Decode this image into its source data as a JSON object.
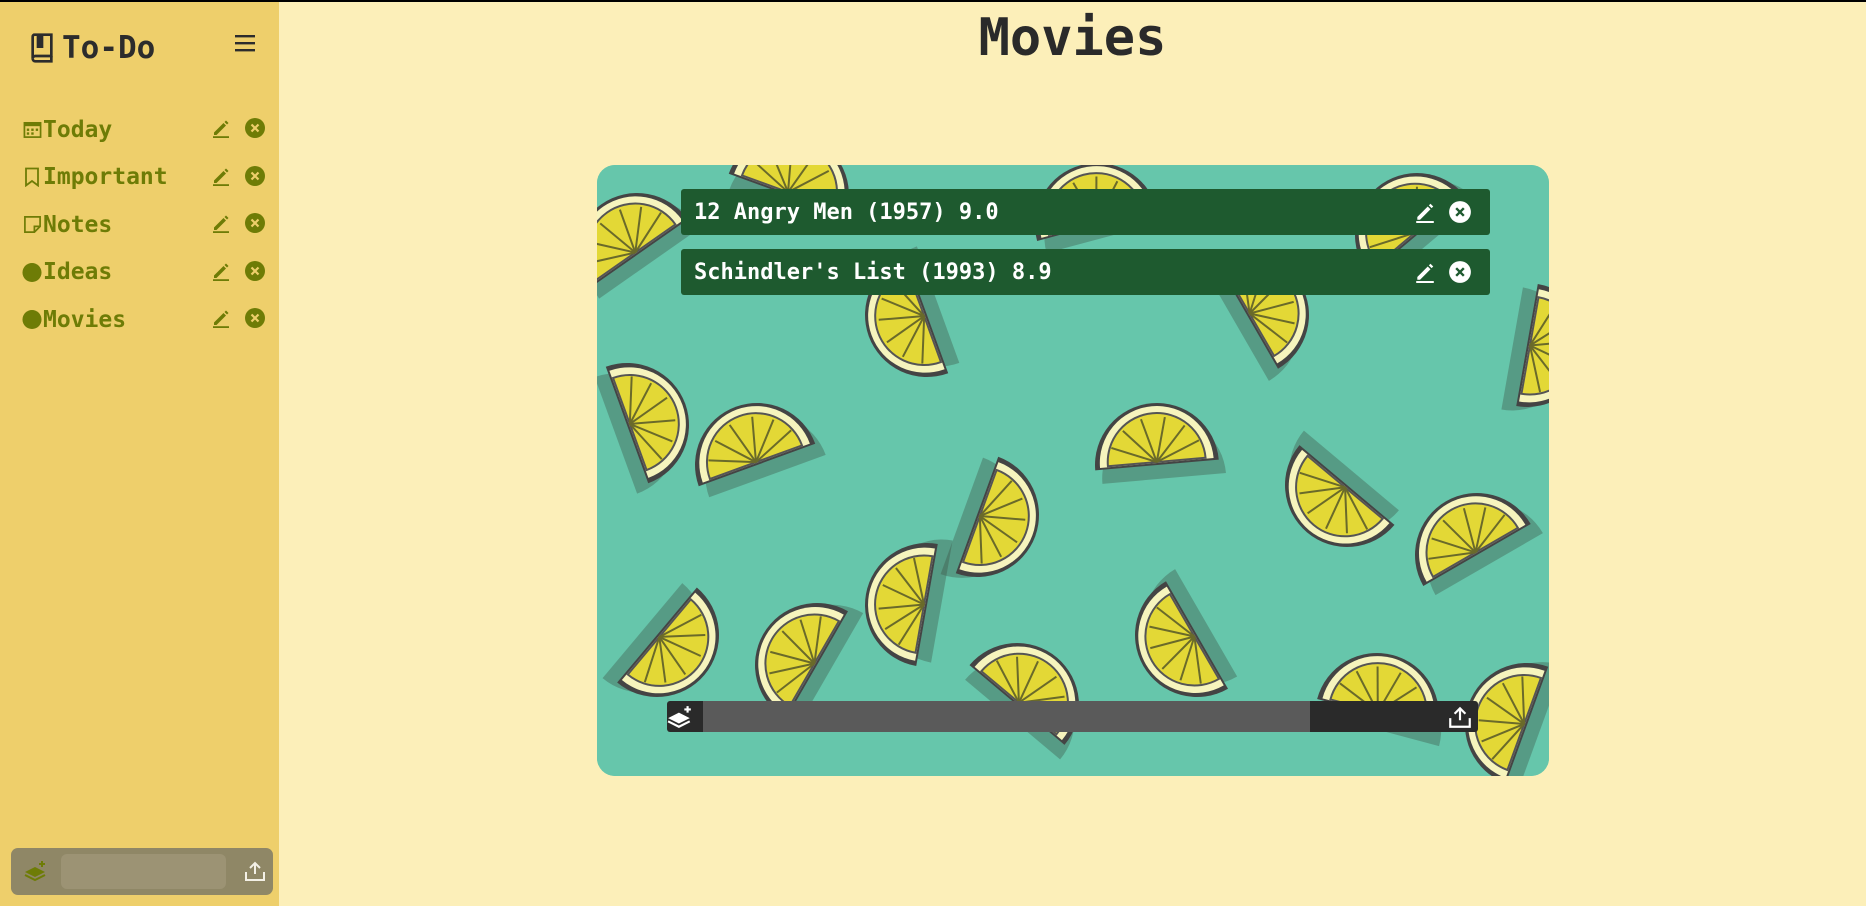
{
  "app": {
    "title": "To-Do"
  },
  "sidebar": {
    "items": [
      {
        "label": "Today",
        "icon": "calendar-icon"
      },
      {
        "label": "Important",
        "icon": "bookmark-icon"
      },
      {
        "label": "Notes",
        "icon": "sticky-note-icon"
      },
      {
        "label": "Ideas",
        "icon": "circle-icon"
      },
      {
        "label": "Movies",
        "icon": "circle-icon"
      }
    ],
    "new_list": {
      "placeholder": ""
    }
  },
  "main": {
    "title": "Movies",
    "tasks": [
      {
        "text": "12 Angry Men (1957) 9.0"
      },
      {
        "text": "Schindler's List (1993) 8.9"
      }
    ],
    "new_task": {
      "placeholder": ""
    }
  },
  "colors": {
    "sidebar_bg": "#eecf6b",
    "page_bg": "#fcefb9",
    "accent_olive": "#6e7c06",
    "task_bg": "#1e5a2f",
    "board_bg": "#66c6ab"
  }
}
